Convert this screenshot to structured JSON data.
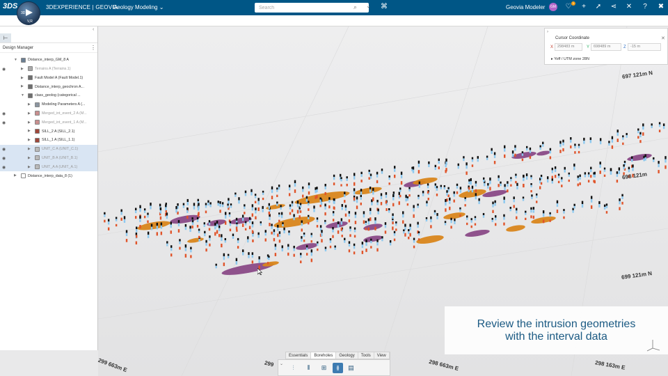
{
  "topbar": {
    "ds_logo": "3DS",
    "compass_labels": [
      "3D",
      "V,R"
    ],
    "brand_prefix": "3DEXPERIENCE | GEOVIA",
    "app_name": "Geology Modeling",
    "app_chevron": "⌄",
    "search_placeholder": "Search",
    "user_name": "Geovia Modeler",
    "user_initials": "GM",
    "notification_count": "1",
    "icons": [
      "chat-icon",
      "plus-icon",
      "share-arrow-icon",
      "share-icon",
      "tools-icon",
      "help-icon",
      "close-x-icon"
    ]
  },
  "design_manager": {
    "title": "Design Manager",
    "items": [
      {
        "label": "Distance_interp_GM_8 A",
        "indent": 0,
        "expanded": true,
        "eye": false,
        "selected": false,
        "dim": false,
        "color": "#6b7f93"
      },
      {
        "label": "Terrains A (Terrains.1)",
        "indent": 1,
        "expanded": false,
        "eye": true,
        "selected": false,
        "dim": true,
        "color": "#a9a9a9"
      },
      {
        "label": "Fault Model A (Fault Model.1)",
        "indent": 1,
        "expanded": false,
        "eye": false,
        "selected": false,
        "dim": false,
        "color": "#6e6e6e"
      },
      {
        "label": "Distance_interp_geochron A...",
        "indent": 1,
        "expanded": false,
        "eye": false,
        "selected": false,
        "dim": false,
        "color": "#6e6e6e"
      },
      {
        "label": "class_geolog (categorical ...",
        "indent": 1,
        "expanded": true,
        "eye": false,
        "selected": false,
        "dim": false,
        "color": "#6e6e6e"
      },
      {
        "label": "Modeling Parameters A (...",
        "indent": 2,
        "expanded": false,
        "eye": false,
        "selected": false,
        "dim": false,
        "color": "#8b95a1"
      },
      {
        "label": "Merged_int_event_2 A (M...",
        "indent": 2,
        "expanded": false,
        "eye": true,
        "selected": false,
        "dim": true,
        "color": "#c98f8f"
      },
      {
        "label": "Merged_int_event_1 A (M...",
        "indent": 2,
        "expanded": false,
        "eye": true,
        "selected": false,
        "dim": true,
        "color": "#c98f8f"
      },
      {
        "label": "SILL_2 A (SILL_2.1)",
        "indent": 2,
        "expanded": false,
        "eye": false,
        "selected": false,
        "dim": false,
        "color": "#a0473a"
      },
      {
        "label": "SILL_1 A (SILL_1.1)",
        "indent": 2,
        "expanded": false,
        "eye": false,
        "selected": false,
        "dim": false,
        "color": "#a0473a"
      },
      {
        "label": "UNIT_C A (UNIT_C.1)",
        "indent": 2,
        "expanded": false,
        "eye": true,
        "selected": true,
        "dim": true,
        "color": "#b9b9b9"
      },
      {
        "label": "UNIT_B A (UNIT_B.1)",
        "indent": 2,
        "expanded": false,
        "eye": true,
        "selected": true,
        "dim": true,
        "color": "#b9b9b9"
      },
      {
        "label": "UNIT_A A (UNIT_A.1)",
        "indent": 2,
        "expanded": false,
        "eye": true,
        "selected": true,
        "dim": true,
        "color": "#b9b9b9"
      },
      {
        "label": "Distance_interp_data_8 (1)",
        "indent": 0,
        "expanded": false,
        "eye": false,
        "selected": false,
        "dim": false,
        "color": "#ffffff"
      }
    ]
  },
  "cursor_coordinate": {
    "title": "Cursor Coordinate",
    "x_label": "X",
    "x_value": "298483 m",
    "y_label": "Y",
    "y_value": "698489 m",
    "z_label": "Z",
    "z_value": "-15 m",
    "utm": "Yoff / UTM zone 28N"
  },
  "direction_labels": [
    "697 121m N",
    "698 121m",
    "699 121m N",
    "299 663m E",
    "299",
    "298 663m E",
    "298 163m E"
  ],
  "overlay": {
    "line1": "Review the intrusion geometries",
    "line2": "with the interval data"
  },
  "bottom_toolbar": {
    "tabs": [
      "Essentials",
      "Boreholes",
      "Geology",
      "Tools",
      "View"
    ],
    "active_tab": "Boreholes",
    "icons": [
      "borehole-icon",
      "borehole-interval-icon",
      "borehole-tool-icon",
      "borehole-active-icon",
      "borehole-report-icon"
    ]
  },
  "colors": {
    "topbar": "#005686",
    "unit_light_blue": "#8ec9ef",
    "unit_orange": "#e0542a",
    "marker_black": "#111111",
    "intrusion_orange": "#d9861c",
    "intrusion_purple": "#8a4a87"
  }
}
